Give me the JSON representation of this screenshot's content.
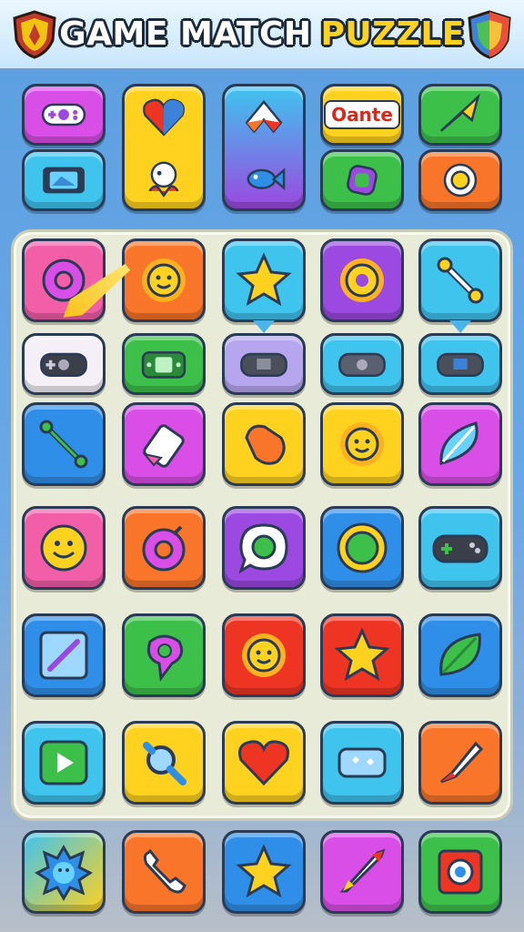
{
  "header": {
    "title_part1": "GAME MATCH",
    "title_part2": "PUZZLE",
    "left_emblem": "shield-emblem-icon",
    "right_emblem": "shield-emblem-icon"
  },
  "top_panel": {
    "special_tile_text": "Oante"
  },
  "colors": {
    "pink": "#f25fa8",
    "purple": "#9b49e0",
    "magenta": "#d94ee6",
    "blue": "#2f8fe8",
    "cyan": "#3fc4ee",
    "yellow": "#ffd21f",
    "orange": "#f8752a",
    "green": "#3cc04a",
    "red": "#ee3524"
  },
  "board": {
    "rows": [
      [
        "gear-icon",
        "sun-icon",
        "star-icon",
        "sun-icon",
        "wrench-icon"
      ],
      [
        "gamepad-icon",
        "handheld-console-icon",
        "gamepad-icon",
        "gamepad-icon",
        "gamepad-icon"
      ],
      [
        "wand-icon",
        "eraser-icon",
        "pill-icon",
        "sun-icon",
        "leaf-shield-icon"
      ],
      [
        "smiley-icon",
        "donut-icon",
        "chat-bubble-icon",
        "flower-icon",
        "gamepad-icon"
      ],
      [
        "pen-icon",
        "map-pin-icon",
        "sun-icon",
        "star-icon",
        "leaf-icon"
      ],
      [
        "play-icon",
        "magnifier-icon",
        "heart-icon",
        "ticket-icon",
        "brush-icon"
      ]
    ]
  },
  "bottom_row": [
    "splash-icon",
    "phone-handset-icon",
    "star-icon",
    "rocket-icon",
    "speaker-icon"
  ]
}
